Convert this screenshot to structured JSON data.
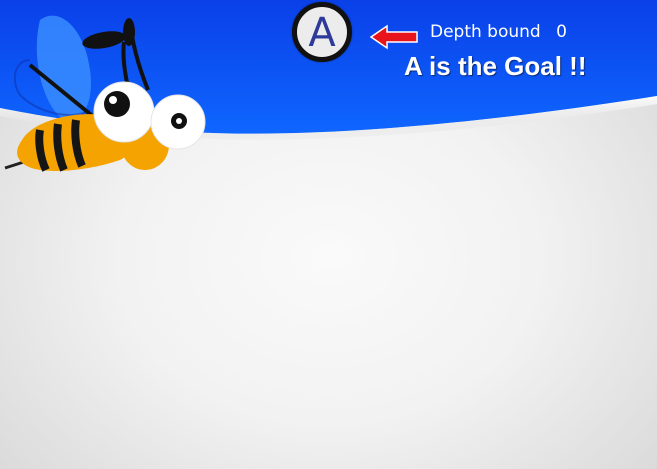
{
  "node": {
    "label": "A"
  },
  "status": {
    "depth_label": "Depth bound",
    "depth_value": "0",
    "goal_text": "A is the Goal !!"
  },
  "icons": {
    "mascot": "bee-icon",
    "pointer": "arrow-left-icon"
  },
  "colors": {
    "header_blue": "#0a55f0",
    "node_text": "#2e3a9a",
    "arrow_red": "#e8131b",
    "bee_yellow": "#f5a300"
  }
}
